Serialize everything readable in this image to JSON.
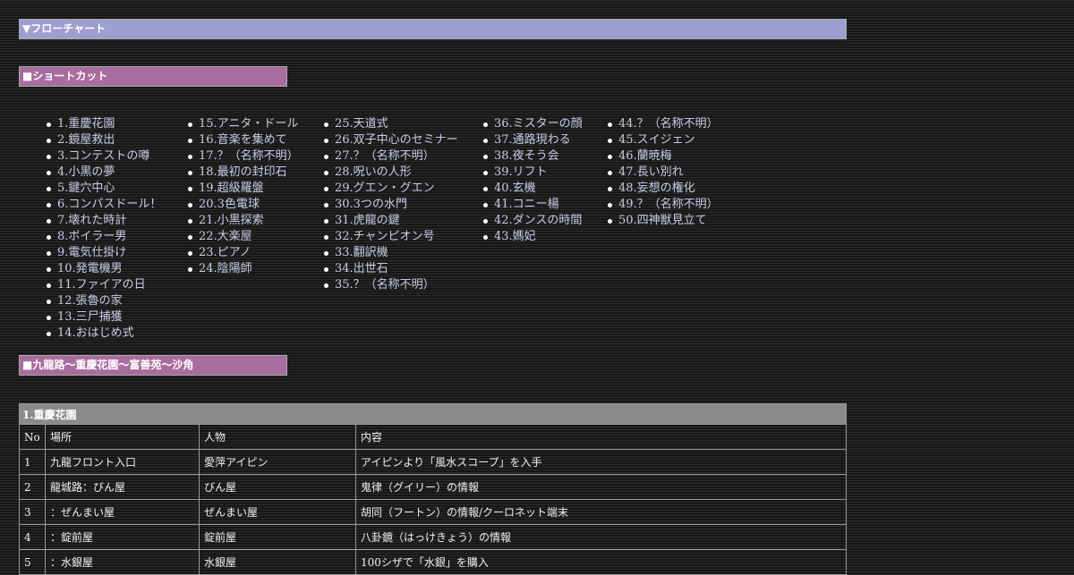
{
  "headers": {
    "flowchart": "▼フローチャート",
    "shortcut": "■ショートカット",
    "area": "■九龍路～重慶花園～富善苑～沙角"
  },
  "shortcuts": {
    "col1": [
      "1.重慶花園",
      "2.鏡屋救出",
      "3.コンテストの噂",
      "4.小黒の夢",
      "5.鍵穴中心",
      "6.コンパスドール！",
      "7.壊れた時計",
      "8.ボイラー男",
      "9.電気仕掛け",
      "10.発電機男",
      "11.ファイアの日",
      "12.張魯の家",
      "13.三尸捕獲",
      "14.おはじめ式"
    ],
    "col2": [
      "15.アニタ・ドール",
      "16.音楽を集めて",
      "17.？（名称不明）",
      "18.最初の封印石",
      "19.超級羅盤",
      "20.3色電球",
      "21.小黒探索",
      "22.大楽屋",
      "23.ピアノ",
      "24.陰陽師"
    ],
    "col3": [
      "25.天道式",
      "26.双子中心のセミナー",
      "27.？（名称不明）",
      "28.呪いの人形",
      "29.グエン・グエン",
      "30.3つの水門",
      "31.虎龍の鍵",
      "32.チャンピオン号",
      "33.翻訳機",
      "34.出世石",
      "35.？（名称不明）"
    ],
    "col4": [
      "36.ミスターの顔",
      "37.通路現わる",
      "38.夜そう会",
      "39.リフト",
      "40.玄機",
      "41.コニー楊",
      "42.ダンスの時間",
      "43.媽妃"
    ],
    "col5": [
      "44.？（名称不明）",
      "45.スイジェン",
      "46.蘭暁梅",
      "47.長い別れ",
      "48.妄想の権化",
      "49.？（名称不明）",
      "50.四神獣見立て"
    ]
  },
  "table": {
    "title": "1.重慶花園",
    "columns": [
      "No",
      "場所",
      "人物",
      "内容"
    ],
    "rows": [
      [
        "1",
        "九龍フロント入口",
        "愛萍アイピン",
        "アイピンより「風水スコープ」を入手"
      ],
      [
        "2",
        "龍城路：びん屋",
        "びん屋",
        "鬼律（グイリー）の情報"
      ],
      [
        "3",
        "：ぜんまい屋",
        "ぜんまい屋",
        "胡同（フートン）の情報/クーロネット端末"
      ],
      [
        "4",
        "：錠前屋",
        "錠前屋",
        "八卦鏡（はっけきょう）の情報"
      ],
      [
        "5",
        "：水銀屋",
        "水銀屋",
        "100シザで「水銀」を購入"
      ]
    ]
  }
}
